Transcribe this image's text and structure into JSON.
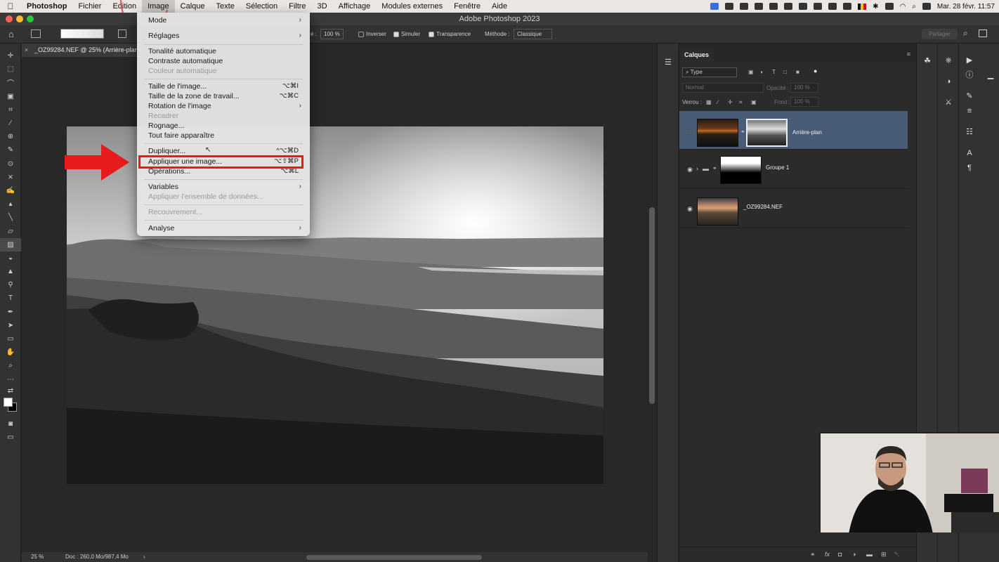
{
  "menubar": {
    "app": "Photoshop",
    "items": [
      "Fichier",
      "Edition",
      "Image",
      "Calque",
      "Texte",
      "Sélection",
      "Filtre",
      "3D",
      "Affichage",
      "Modules externes",
      "Fenêtre",
      "Aide"
    ],
    "active_item": "Image",
    "datetime": "Mar. 28 févr.  11:57"
  },
  "window": {
    "title": "Adobe Photoshop 2023"
  },
  "options_bar": {
    "opacity_value": "100 %",
    "opacity_label": "é :",
    "inverser": "Inverser",
    "simuler": "Simuler",
    "transparence": "Transparence",
    "methode_label": "Méthode :",
    "methode_value": "Classique",
    "share_button": "Partager"
  },
  "document": {
    "tab_title": "_OZ99284.NEF @ 25% (Arrière-plan",
    "zoom": "25 %",
    "doc_info": "Doc : 260,0 Mo/987,4 Mo"
  },
  "image_menu": {
    "items": [
      {
        "label": "Mode",
        "submenu": true
      },
      {
        "label": "Réglages",
        "submenu": true
      },
      {
        "label": "Tonalité automatique",
        "shortcut": ""
      },
      {
        "label": "Contraste automatique",
        "shortcut": ""
      },
      {
        "label": "Couleur automatique",
        "disabled": true
      },
      {
        "label": "Taille de l'image...",
        "shortcut": "⌥⌘I"
      },
      {
        "label": "Taille de la zone de travail...",
        "shortcut": "⌥⌘C"
      },
      {
        "label": "Rotation de l'image",
        "submenu": true
      },
      {
        "label": "Recadrer",
        "disabled": true
      },
      {
        "label": "Rognage..."
      },
      {
        "label": "Tout faire apparaître"
      },
      {
        "label": "Dupliquer...",
        "shortcut": "^⌥⌘D"
      },
      {
        "label": "Appliquer une image...",
        "shortcut": "⌥⇧⌘P"
      },
      {
        "label": "Opérations...",
        "shortcut": "⌥⌘L"
      },
      {
        "label": "Variables",
        "submenu": true
      },
      {
        "label": "Appliquer l'ensemble de données...",
        "disabled": true
      },
      {
        "label": "Recouvrement...",
        "disabled": true
      },
      {
        "label": "Analyse",
        "submenu": true
      }
    ],
    "highlighted_item": "Appliquer une image..."
  },
  "layers_panel": {
    "tab": "Calques",
    "filter_type": "Type",
    "blend_mode": "Normal",
    "opacity_label": "Opacité :",
    "opacity_value": "100 %",
    "lock_label": "Verrou :",
    "fill_label": "Fond :",
    "fill_value": "100 %",
    "layers": [
      {
        "name": "Arrière-plan",
        "active": true,
        "visible": false,
        "has_mask": true
      },
      {
        "name": "Groupe 1",
        "active": false,
        "visible": true,
        "is_group": true
      },
      {
        "name": "_OZ99284.NEF",
        "active": false,
        "visible": true
      }
    ]
  },
  "colors": {
    "accent_red": "#e61b1b",
    "active_layer": "#485b77",
    "panel_bg": "#2b2b2b"
  }
}
